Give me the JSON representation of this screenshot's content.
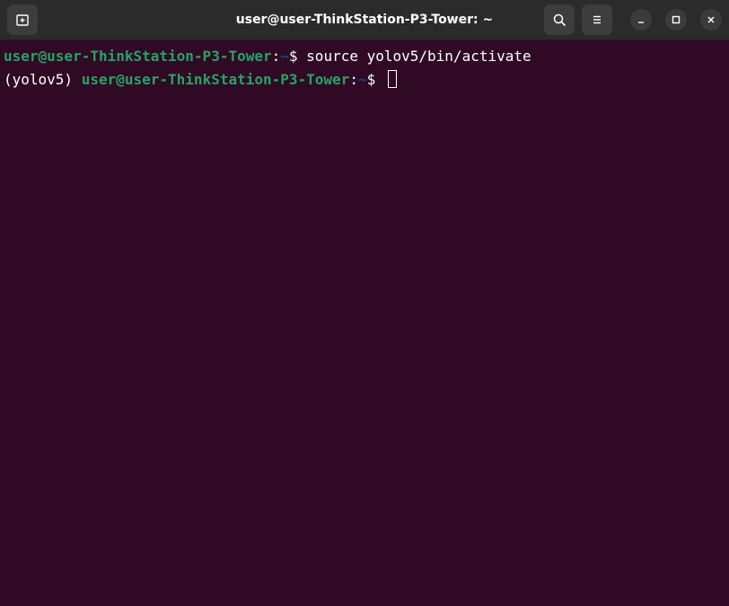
{
  "window": {
    "title": "user@user-ThinkStation-P3-Tower: ~"
  },
  "icons": {
    "new_tab": "new-tab-icon",
    "search": "search-icon",
    "menu": "hamburger-menu-icon",
    "minimize": "minimize-icon",
    "maximize": "maximize-icon",
    "close": "close-icon"
  },
  "terminal": {
    "lines": [
      {
        "prefix": "",
        "user_host": "user@user-ThinkStation-P3-Tower",
        "colon": ":",
        "path": "~",
        "prompt": "$ ",
        "command": "source yolov5/bin/activate"
      },
      {
        "prefix": "(yolov5) ",
        "user_host": "user@user-ThinkStation-P3-Tower",
        "colon": ":",
        "path": "~",
        "prompt": "$ ",
        "command": ""
      }
    ]
  },
  "colors": {
    "background": "#300a24",
    "titlebar": "#2b2b2b",
    "user_host": "#26a269",
    "path": "#12488b",
    "text": "#ffffff"
  }
}
